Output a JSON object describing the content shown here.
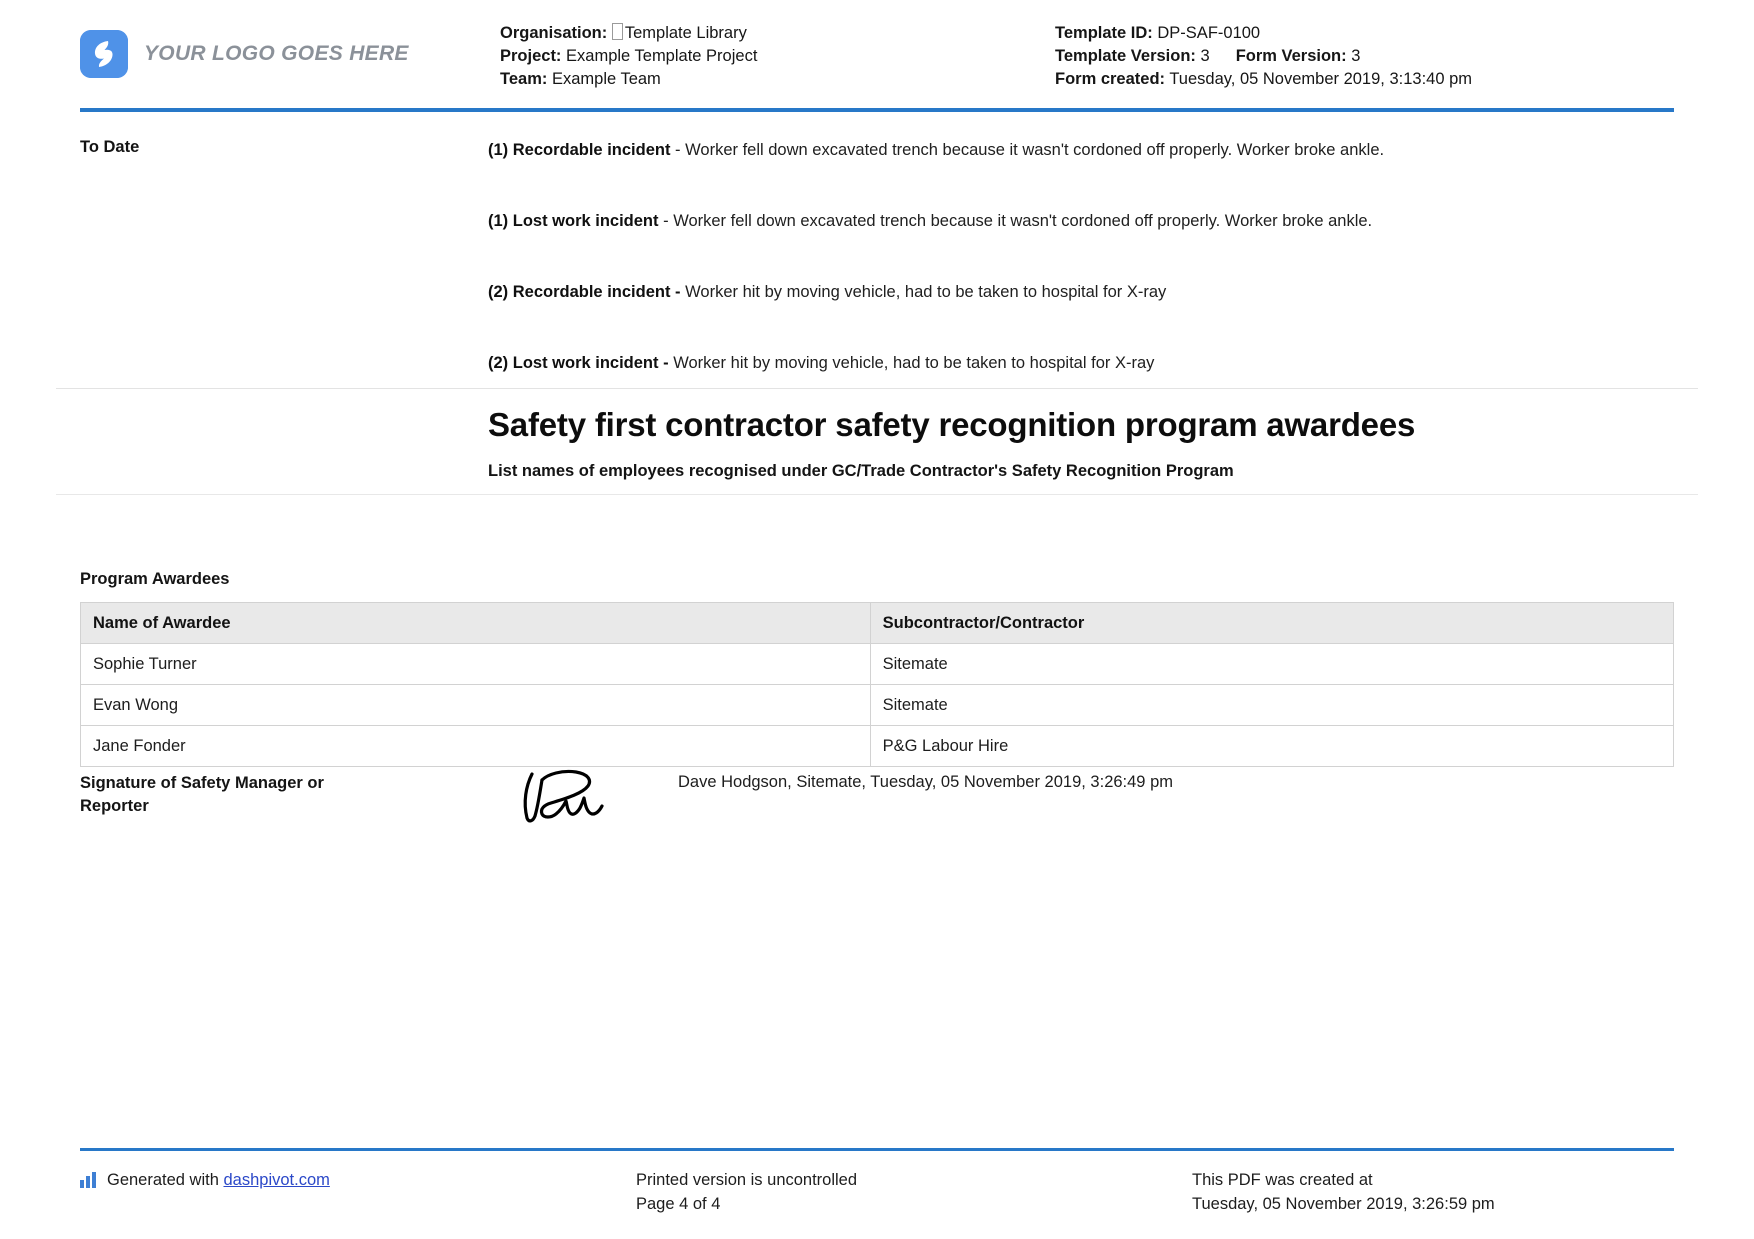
{
  "header": {
    "logo": {
      "icon": "app-logo-icon",
      "text": "YOUR LOGO GOES HERE",
      "color": "#4f92e8"
    },
    "left_meta": {
      "organisation_label": "Organisation:",
      "organisation_value": "Template Library",
      "project_label": "Project:",
      "project_value": "Example Template Project",
      "team_label": "Team:",
      "team_value": "Example Team"
    },
    "right_meta": {
      "template_id_label": "Template ID:",
      "template_id_value": "DP-SAF-0100",
      "template_version_label": "Template Version:",
      "template_version_value": "3",
      "form_version_label": "Form Version:",
      "form_version_value": "3",
      "form_created_label": "Form created:",
      "form_created_value": "Tuesday, 05 November 2019, 3:13:40 pm"
    },
    "rule_color": "#2878c8"
  },
  "to_date": {
    "label": "To Date",
    "incidents": [
      {
        "title": "(1) Recordable incident",
        "separator": " - ",
        "description": "Worker fell down excavated trench because it wasn't cordoned off properly. Worker broke ankle."
      },
      {
        "title": "(1) Lost work incident",
        "separator": " - ",
        "description": "Worker fell down excavated trench because it wasn't cordoned off properly. Worker broke ankle."
      },
      {
        "title": "(2) Recordable incident -",
        "separator": " ",
        "description": "Worker hit by moving vehicle, had to be taken to hospital for X-ray"
      },
      {
        "title": "(2) Lost work incident -",
        "separator": " ",
        "description": "Worker hit by moving vehicle, had to be taken to hospital for X-ray"
      }
    ]
  },
  "title_block": {
    "title": "Safety first contractor safety recognition program awardees",
    "subtitle": "List names of employees recognised under GC/Trade Contractor's Safety Recognition Program"
  },
  "awardees_table": {
    "caption": "Program Awardees",
    "columns": [
      "Name of Awardee",
      "Subcontractor/Contractor"
    ],
    "rows": [
      [
        "Sophie Turner",
        "Sitemate"
      ],
      [
        "Evan Wong",
        "Sitemate"
      ],
      [
        "Jane Fonder",
        "P&G Labour Hire"
      ]
    ]
  },
  "signature": {
    "label_line_1": "Signature of Safety Manager or",
    "label_line_2": "Reporter",
    "image_name": "handwritten-signature",
    "meta": "Dave Hodgson, Sitemate, Tuesday, 05 November 2019, 3:26:49 pm"
  },
  "footer": {
    "generated_prefix": "Generated with ",
    "generated_link": "dashpivot.com",
    "printed_notice": "Printed version is uncontrolled",
    "page_number": "Page 4 of 4",
    "created_label": "This PDF was created at",
    "created_value": "Tuesday, 05 November 2019, 3:26:59 pm",
    "rule_color": "#2878c8",
    "link_color": "#2b48c8"
  }
}
